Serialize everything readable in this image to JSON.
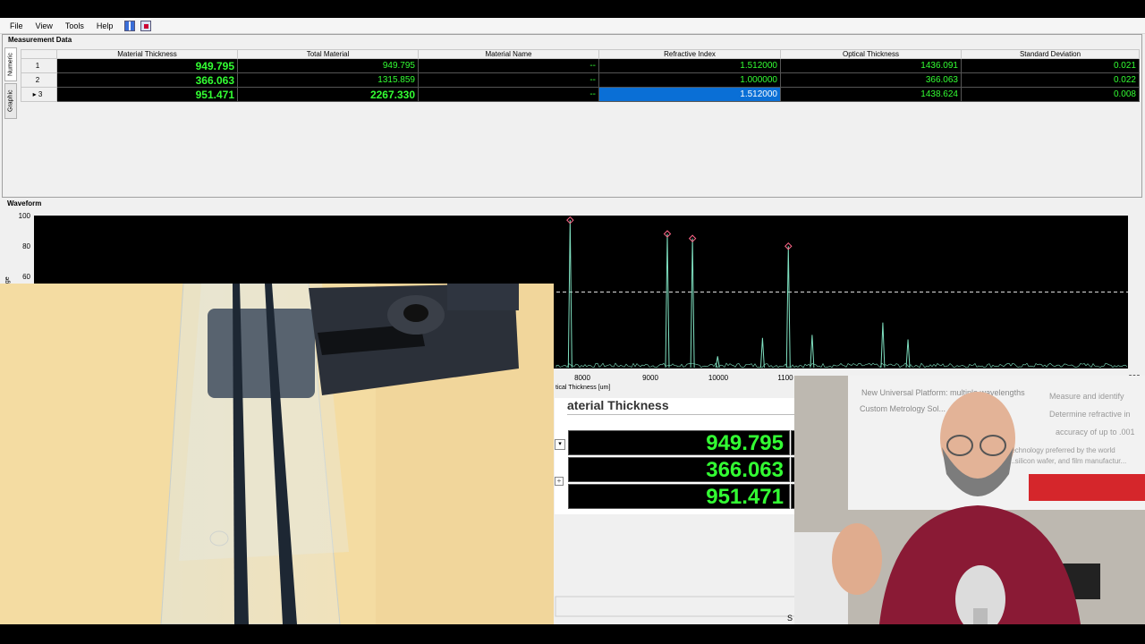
{
  "menu": {
    "items": [
      "File",
      "View",
      "Tools",
      "Help"
    ]
  },
  "measurement": {
    "title": "Measurement Data",
    "tabs": [
      "Numeric",
      "Graphic"
    ],
    "columns": [
      "Material Thickness",
      "Total Material",
      "Material Name",
      "Refractive Index",
      "Optical Thickness",
      "Standard Deviation"
    ],
    "rows": [
      {
        "num": "1",
        "thickness": "949.795",
        "total": "949.795",
        "name": "--",
        "ri": "1.512000",
        "optical": "1436.091",
        "stdev": "0.021"
      },
      {
        "num": "2",
        "thickness": "366.063",
        "total": "1315.859",
        "name": "--",
        "ri": "1.000000",
        "optical": "366.063",
        "stdev": "0.022"
      },
      {
        "num": "3",
        "thickness": "951.471",
        "total": "2267.330",
        "name": "--",
        "ri": "1.512000",
        "optical": "1438.624",
        "stdev": "0.008"
      }
    ],
    "current_row_marker": "▸"
  },
  "waveform": {
    "title": "Waveform",
    "y_ticks_visible": [
      "100",
      "80",
      "60"
    ],
    "y_axis_fragment": "nge",
    "x_ticks_visible": [
      "8000",
      "9000",
      "10000",
      "1100",
      "000"
    ],
    "x_label_fragment": "tical Thickness [um]"
  },
  "chart_data": {
    "type": "line",
    "x_axis_label": "Optical Thickness [um]",
    "ylim": [
      0,
      100
    ],
    "xlim": [
      7800,
      13900
    ],
    "threshold": 50,
    "peaks": [
      {
        "x": 7820,
        "y": 97,
        "marked": true
      },
      {
        "x": 9250,
        "y": 88,
        "marked": true
      },
      {
        "x": 9620,
        "y": 85,
        "marked": true
      },
      {
        "x": 9990,
        "y": 8,
        "marked": false
      },
      {
        "x": 10650,
        "y": 20,
        "marked": false
      },
      {
        "x": 11030,
        "y": 80,
        "marked": true
      },
      {
        "x": 11380,
        "y": 22,
        "marked": false
      },
      {
        "x": 12420,
        "y": 30,
        "marked": false
      },
      {
        "x": 12790,
        "y": 19,
        "marked": false
      }
    ],
    "colors": {
      "trace": "#7fe0c0",
      "marker": "#ff6688",
      "threshold": "#dddddd",
      "plot_bg": "#000000"
    }
  },
  "zoom_overlay": {
    "header_fragment": "aterial Thickness",
    "header_right_fragment": "To",
    "values": [
      "949.795",
      "366.063",
      "951.471"
    ]
  },
  "presenter": {
    "poster_lines": [
      "New Universal Platform: multiple wavelengths",
      "Custom Metrology Sol...",
      "Measure and identify",
      "Determine refractive in",
      "accuracy of up to .001",
      "technology preferred by the world",
      "...silicon wafer, and film manufactur..."
    ],
    "partial_text_bottom": "S"
  },
  "colors": {
    "table_value": "#33ff33",
    "selected_cell": "#0a6fd6"
  }
}
